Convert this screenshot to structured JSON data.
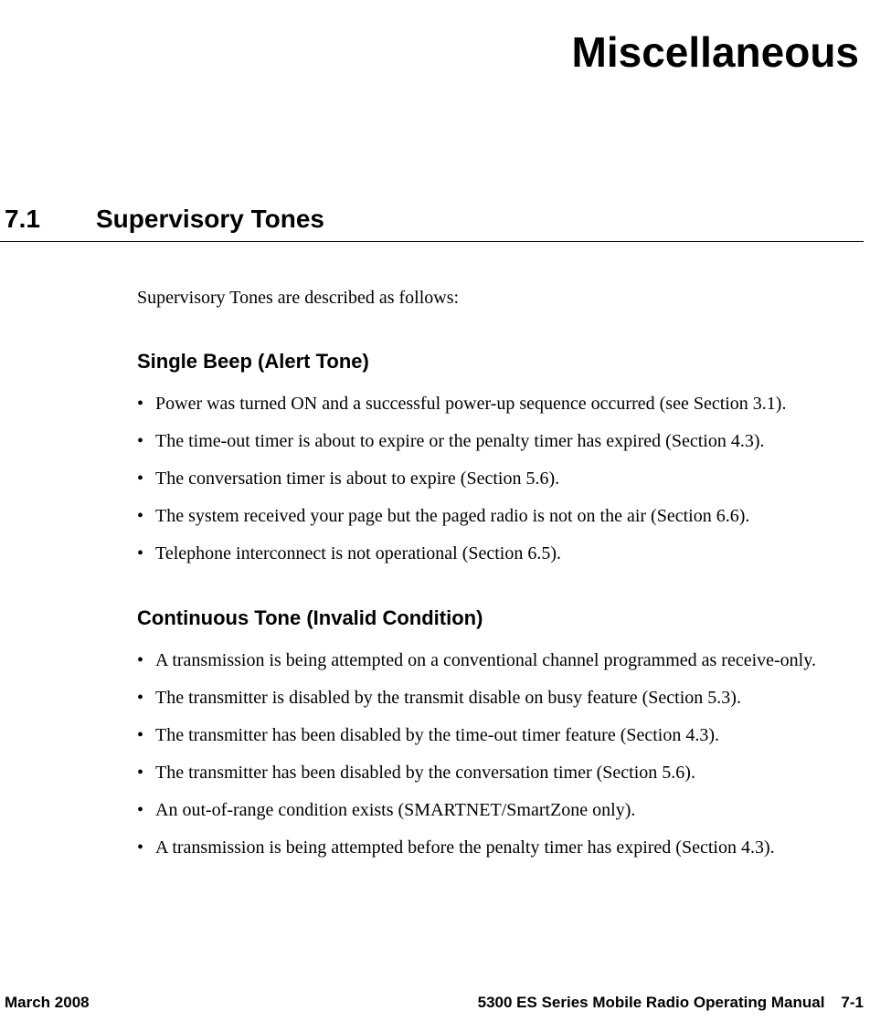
{
  "chapter": {
    "title": "Miscellaneous"
  },
  "section": {
    "number": "7.1",
    "title": "Supervisory Tones",
    "intro": "Supervisory Tones are described as follows:"
  },
  "subsections": [
    {
      "title": "Single Beep (Alert Tone)",
      "items": [
        "Power was turned ON and a successful power-up sequence occurred (see Section 3.1).",
        "The time-out timer is about to expire or the penalty timer has expired (Section 4.3).",
        "The conversation timer is about to expire (Section 5.6).",
        "The system received your page but the paged radio is not on the air (Section 6.6).",
        "Telephone interconnect is not operational (Section 6.5)."
      ]
    },
    {
      "title": "Continuous Tone (Invalid Condition)",
      "items": [
        "A transmission is being attempted on a conventional channel programmed as receive-only.",
        "The transmitter is disabled by the transmit disable on busy feature (Section 5.3).",
        "The transmitter has been disabled by the time-out timer feature (Section 4.3).",
        "The transmitter has been disabled by the conversation timer (Section 5.6).",
        "An out-of-range condition exists (SMARTNET/SmartZone only).",
        "A transmission is being attempted before the penalty timer has expired (Section 4.3)."
      ]
    }
  ],
  "footer": {
    "date": "March 2008",
    "manual": "5300 ES Series Mobile Radio Operating Manual",
    "page": "7-1"
  }
}
